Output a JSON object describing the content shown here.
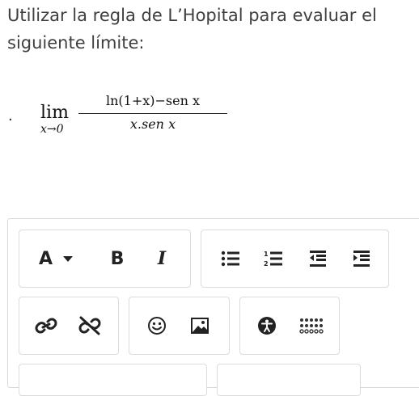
{
  "question": {
    "text": "Utilizar la regla de L’Hopital para evaluar el siguiente límite:"
  },
  "math": {
    "bullet": ".",
    "lim": "lim",
    "sub": "x→0",
    "numerator": "ln(1+x)−sen x",
    "denominator": "x.sen x"
  },
  "toolbar": {
    "font_color_label": "A",
    "bold_label": "B",
    "italic_label": "I",
    "icons": [
      "font-color-icon",
      "dropdown-caret-icon",
      "bold-icon",
      "italic-icon",
      "bullet-list-icon",
      "numbered-list-icon",
      "outdent-icon",
      "indent-icon",
      "link-icon",
      "unlink-icon",
      "emoji-icon",
      "image-icon",
      "accessibility-icon",
      "keyboard-icon"
    ]
  }
}
